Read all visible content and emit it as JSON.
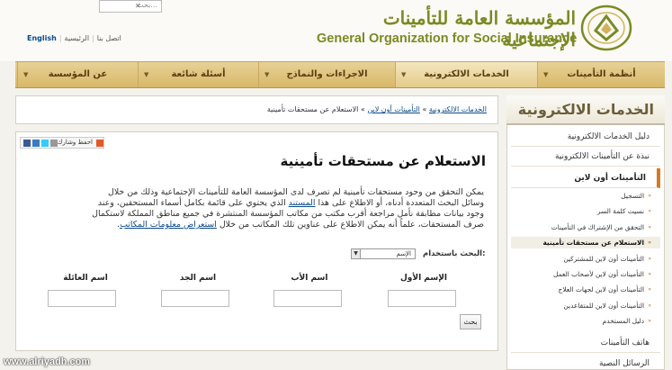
{
  "header": {
    "search_placeholder": "بحث...",
    "lang_english": "English",
    "lang_contact": "اتصل بنا",
    "lang_home": "الرئيسية",
    "org_name_ar": "المؤسسة العامة للتأمينات الإجتماعية",
    "org_name_en": "General Organization for Social Insurance"
  },
  "nav": {
    "items": [
      {
        "label": "أنظمة التأمينات"
      },
      {
        "label": "الخدمات الالكترونية"
      },
      {
        "label": "الاجراءات والنماذج"
      },
      {
        "label": "أسئلة شائعة"
      },
      {
        "label": "عن المؤسسة"
      }
    ]
  },
  "breadcrumb": {
    "c1": "الخدمات الالكترونية",
    "sep1": "»",
    "c2": "التأمينات أون لاين",
    "sep2": "»",
    "c3": "الاستعلام عن مستحقات تأمينية"
  },
  "share": {
    "label": "احفظ وشارك"
  },
  "main": {
    "title": "الاستعلام عن مستحقات تأمينية",
    "intro_1": "يمكن التحقق من وجود مستحقات تأمينية لم تصرف لدى المؤسسة العامة للتأمينات الإجتماعية وذلك من خلال",
    "intro_2a": "وسائل البحث المتعددة أدناه، أو الاطلاع على هذا",
    "intro_2_link": "المستند",
    "intro_2b": "الذي يحتوي على قائمة بكامل أسماء المستحقين، وعند",
    "intro_3": "وجود بيانات مطابقة نأمل مراجعة أقرب مكتب من مكاتب المؤسسة المنتشرة في جميع مناطق المملكة لاستكمال",
    "intro_4a": "صرف المستحقات، علماً أنه يمكن الاطلاع على عناوين تلك المكاتب من خلال",
    "intro_4_link": "استعراض معلومات المكاتب",
    "intro_4b": ".",
    "search_by_label": "البحث باستخدام:",
    "search_by_value": "الإسم",
    "fields": {
      "first_name": "الإسم الأول",
      "father_name": "اسم الأب",
      "grandfather_name": "اسم الجد",
      "family_name": "اسم العائلة"
    },
    "search_button": "بحث"
  },
  "sidebar": {
    "title": "الخدمات الالكترونية",
    "items": [
      {
        "label": "دليل الخدمات الالكترونية"
      },
      {
        "label": "نبذة عن التأمينات الالكترونية"
      },
      {
        "label": "التأمينات أون لاين"
      }
    ],
    "subitems": [
      {
        "label": "التسجيل"
      },
      {
        "label": "نسيت كلمة السر"
      },
      {
        "label": "التحقق من الإشتراك في التأمينات"
      },
      {
        "label": "الاستعلام عن مستحقات تأمينية"
      },
      {
        "label": "التأمينات أون لاين للمشتركين"
      },
      {
        "label": "التأمينات أون لاين لأصحاب العمل"
      },
      {
        "label": "التأمينات أون لاين لجهات العلاج"
      },
      {
        "label": "التأمينات أون لاين للمتقاعدين"
      },
      {
        "label": "دليل المستخدم"
      }
    ],
    "bottom_items": [
      {
        "label": "هاتف التأمينات"
      },
      {
        "label": "الرسائل النصية"
      }
    ]
  },
  "watermark": "www.alriyadh.com",
  "colors": {
    "brand_olive": "#7a8a23",
    "nav_gold": "#d8b868",
    "accent_orange": "#d57a22",
    "link_blue": "#0a4a8a"
  }
}
